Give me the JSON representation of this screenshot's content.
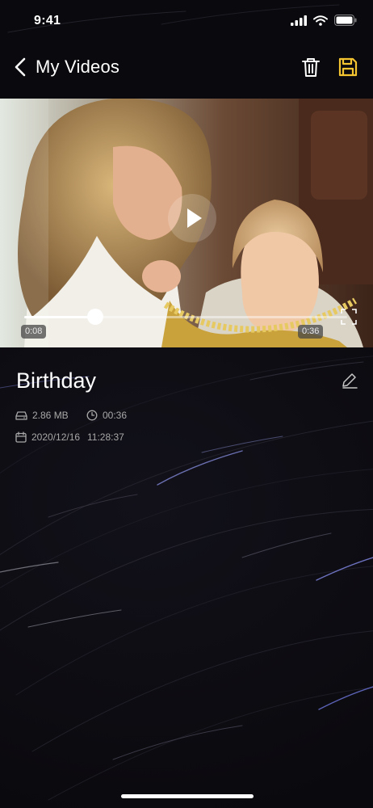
{
  "status_bar": {
    "time": "9:41"
  },
  "header": {
    "title": "My Videos",
    "back_icon": "chevron-left-icon",
    "delete_icon": "trash-icon",
    "save_icon": "floppy-disk-icon",
    "save_color": "#f5c531"
  },
  "video": {
    "current_time": "0:08",
    "duration": "0:36",
    "progress": 0.22
  },
  "details": {
    "title": "Birthday",
    "file_size": "2.86 MB",
    "length": "00:36",
    "date": "2020/12/16",
    "time": "11:28:37"
  }
}
